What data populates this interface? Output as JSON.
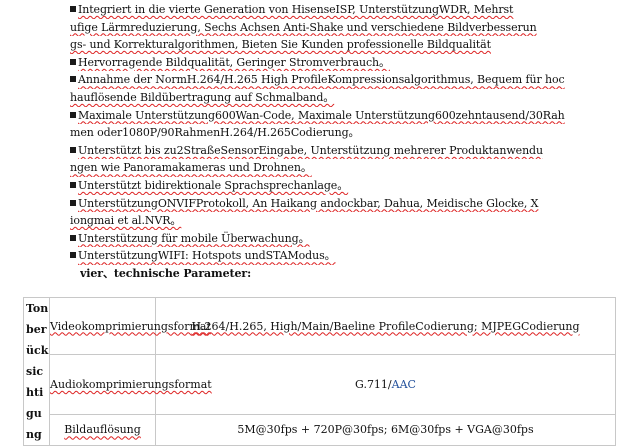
{
  "bullets": [
    {
      "id": "b1",
      "parts": [
        "Integriert in die vierte Generation von HisenseISP, UnterstützungWDR, Mehrst"
      ]
    },
    {
      "id": "b1c",
      "parts": [
        "ufige Lärmreduzierung, Sechs Achsen Anti-Shake und verschiedene Bildverbesserun"
      ]
    },
    {
      "id": "b1d",
      "parts": [
        "gs- und Korrekturalgorithmen, Bieten Sie Kunden professionelle Bildqualität"
      ]
    },
    {
      "id": "b2",
      "parts": [
        "Hervorragende Bildqualität, Geringer Stromverbrauch。"
      ]
    },
    {
      "id": "b3",
      "parts": [
        "Annahme der NormH.264/H.265 High ProfileKompressionsalgorithmus, Bequem für hoc"
      ]
    },
    {
      "id": "b3c",
      "parts": [
        "hauflösende Bildübertragung auf Schmalband。"
      ]
    },
    {
      "id": "b4",
      "parts": [
        "Maximale Unterstützung600Wan-Code, Maximale Unterstützung600zehntausend/30Rah"
      ]
    },
    {
      "id": "b4c",
      "parts": [
        "men oder1080P/90RahmenH.264/H.265Codierung。"
      ]
    },
    {
      "id": "b5",
      "parts": [
        "Unterstützt bis zu2StraßeSensorEingabe, Unterstützung mehrerer Produktanwendu"
      ]
    },
    {
      "id": "b5c",
      "parts": [
        "ngen wie Panoramakameras und Drohnen。"
      ]
    },
    {
      "id": "b6",
      "parts": [
        "Unterstützt bidirektionale Sprachsprechanlage。"
      ]
    },
    {
      "id": "b7",
      "parts": [
        "UnterstützungONVIFProtokoll, An Haikang andockbar, Dahua, Meidische Glocke, X"
      ]
    },
    {
      "id": "b7c",
      "parts": [
        "iongmai et al.NVR。"
      ]
    },
    {
      "id": "b8",
      "parts": [
        "Unterstützung für mobile Überwachung。"
      ]
    },
    {
      "id": "b9",
      "parts": [
        "UnterstützungWIFI: Hotspots undSTAModus。"
      ]
    }
  ],
  "section_heading": "vier、technische Parameter:",
  "table": {
    "group_label": "Tonberücksichtigung",
    "rows": [
      {
        "label": "Videokomprimierungsformat",
        "value": "H.264/H.265, High/Main/Baeline ProfileCodierung; MJPEGCodierung"
      },
      {
        "label": "Audiokomprimierungsformat",
        "value_prefix": "G.711/",
        "value_suffix": "AAC"
      },
      {
        "label": "Bildauflösung",
        "value": "5M@30fps + 720P@30fps; 6M@30fps + VGA@30fps"
      }
    ]
  },
  "colors": {
    "text": "#111111",
    "spellcheck_underline": "#dd2222",
    "link_blue": "#1f4e9a",
    "border": "#c8c8c8"
  }
}
